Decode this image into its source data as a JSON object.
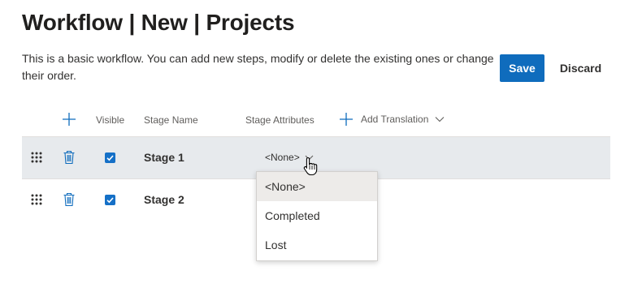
{
  "page": {
    "title": "Workflow | New | Projects",
    "description": "This is a basic workflow. You can add new steps, modify or delete the existing ones or change their order."
  },
  "actions": {
    "save_label": "Save",
    "discard_label": "Discard"
  },
  "columns": {
    "visible": "Visible",
    "stage_name": "Stage Name",
    "stage_attributes": "Stage Attributes",
    "add_translation": "Add Translation"
  },
  "rows": [
    {
      "stage_name": "Stage 1",
      "visible": true,
      "attribute": "<None>",
      "selected": true
    },
    {
      "stage_name": "Stage 2",
      "visible": true
    }
  ],
  "attribute_dropdown": {
    "options": [
      "<None>",
      "Completed",
      "Lost"
    ],
    "selected": "<None>"
  },
  "colors": {
    "accent": "#0f6cbd",
    "checkbox": "#1570c7",
    "selected_row": "#e7eaed"
  },
  "icons": [
    "add-icon",
    "chevron-down-icon",
    "drag-handle-icon",
    "trash-icon",
    "checkmark-icon",
    "hand-pointer-cursor-icon"
  ]
}
